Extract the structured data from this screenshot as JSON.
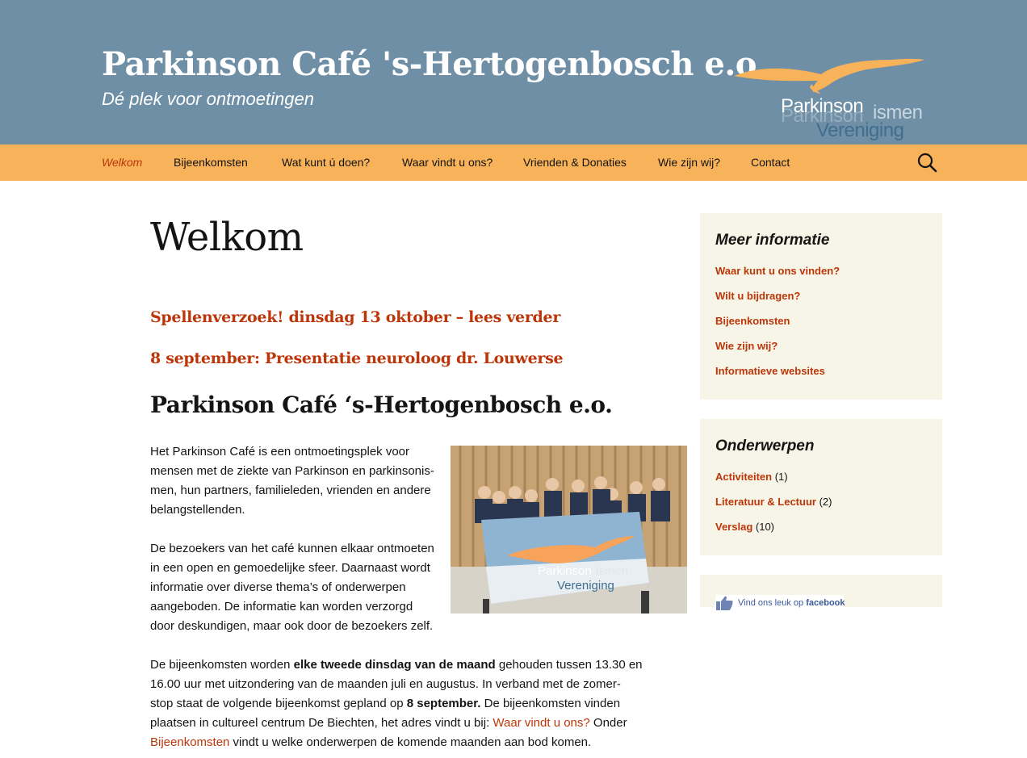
{
  "header": {
    "title": "Parkinson Café 's-Hertogenbosch e.o.",
    "tagline": "Dé plek voor ontmoetingen",
    "logo_word1": "Parkinson",
    "logo_word1b": "ismen",
    "logo_word2": "Vereniging"
  },
  "nav": {
    "items": [
      "Welkom",
      "Bijeenkomsten",
      "Wat kunt ú doen?",
      "Waar vindt u ons?",
      "Vrienden & Donaties",
      "Wie zijn wij?",
      "Contact"
    ],
    "active_index": 0
  },
  "main": {
    "page_title": "Welkom",
    "announcement1": "Spellenverzoek! dinsdag 13 oktober – lees verder",
    "announcement2": "8 september: Presentatie neuroloog dr. Louwerse",
    "section_title": "Parkinson Café ‘s-Hertogenbosch e.o.",
    "p1_lines": [
      "Het Parkinson Café is een ontmoetingsplek voor",
      "mensen met de ziekte van Parkinson en parkinsonis-",
      "men, hun partners, familieleden, vrienden en andere",
      "belangstellenden."
    ],
    "p2_lines": [
      "De bezoekers van het café kunnen elkaar ontmoeten",
      "in een open en gemoedelijke sfeer. Daarnaast wordt",
      "informatie over diverse thema’s of onderwerpen",
      "aangeboden. De informatie kan worden verzorgd",
      "door deskundigen, maar ook door de bezoekers zelf."
    ],
    "p3": {
      "l1_a": "De bijeenkomsten worden ",
      "l1_b": "elke tweede dinsdag van de maand",
      "l1_c": " gehouden tussen 13.30 en",
      "l2": "16.00 uur met uitzondering van de maanden juli en augustus. In verband met de zomer-",
      "l3_a": "stop staat de volgende bijeenkomst gepland op ",
      "l3_b": "8 september.",
      "l3_c": " De bijeenkomsten vinden",
      "l4_a": "plaatsen in cultureel centrum De Biechten, het adres vindt u bij: ",
      "l4_link": "Waar vindt u ons?",
      "l4_c": " Onder",
      "l5_link": "Bijeenkomsten",
      "l5_b": " vindt u welke onderwerpen de komende maanden aan bod komen."
    },
    "photo_flag_word1": "Parkinson",
    "photo_flag_word1b": "ismen",
    "photo_flag_word2": "Vereniging"
  },
  "sidebar": {
    "widget1": {
      "title": "Meer informatie",
      "links": [
        "Waar kunt u ons vinden?",
        "Wilt u bijdragen?",
        "Bijeenkomsten",
        "Wie zijn wij?",
        "Informatieve websites"
      ]
    },
    "widget2": {
      "title": "Onderwerpen",
      "items": [
        {
          "label": "Activiteiten",
          "count": "(1)"
        },
        {
          "label": "Literatuur & Lectuur",
          "count": "(2)"
        },
        {
          "label": "Verslag",
          "count": "(10)"
        }
      ]
    },
    "widget3": {
      "fb_text": "Vind ons leuk op ",
      "fb_brand": "facebook"
    }
  },
  "colors": {
    "header_bg": "#6e8fa6",
    "nav_bg": "#f7b25a",
    "accent": "#bc360a",
    "widget_bg": "#f7f5e7"
  }
}
